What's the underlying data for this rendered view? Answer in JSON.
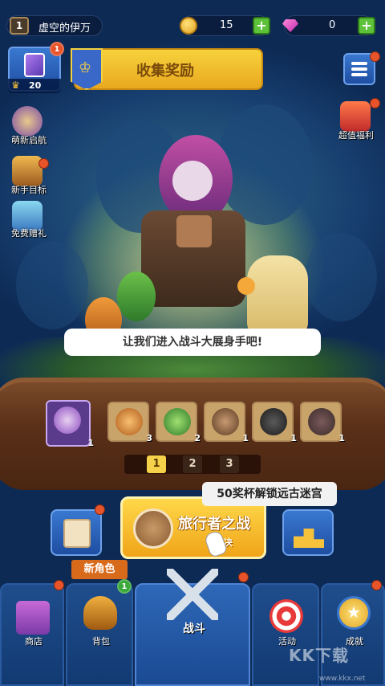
{
  "player": {
    "level": "1",
    "name": "虚空的伊万"
  },
  "currency": {
    "coins": "15",
    "gems": "0",
    "plus": "+"
  },
  "card_widget": {
    "badge": "1",
    "trophies": "20"
  },
  "banner": {
    "label": "收集奖励"
  },
  "left_menu": [
    {
      "label": "萌新启航",
      "icon": "hero-portrait-icon"
    },
    {
      "label": "新手目标",
      "icon": "ship-icon"
    },
    {
      "label": "免费赠礼",
      "icon": "gift-icon"
    }
  ],
  "right_menu": {
    "deal_label": "超值福利",
    "deal_icon": "gift-box-icon"
  },
  "speech": "让我们进入战斗大展身手吧!",
  "roster": [
    {
      "icon": "purple-mage-portrait",
      "count": "1"
    },
    {
      "icon": "orange-archer-portrait",
      "count": "3"
    },
    {
      "icon": "green-elf-portrait",
      "count": "2"
    },
    {
      "icon": "golem-portrait",
      "count": "1"
    },
    {
      "icon": "bomb-portrait",
      "count": "1"
    },
    {
      "icon": "cannon-portrait",
      "count": "1"
    }
  ],
  "pages": [
    "1",
    "2",
    "3"
  ],
  "tooltip": "50奖杯解锁远古迷宫",
  "battle": {
    "title": "旅行者之战",
    "subtitle": "对决"
  },
  "new_role_tag": "新角色",
  "nav": [
    {
      "label": "商店",
      "icon": "shop-icon"
    },
    {
      "label": "背包",
      "icon": "helmet-icon",
      "badge": "1"
    },
    {
      "label": "战斗",
      "icon": "crossed-swords-icon"
    },
    {
      "label": "活动",
      "icon": "target-icon"
    },
    {
      "label": "成就",
      "icon": "star-medal-icon"
    }
  ],
  "watermark": {
    "brand": "KK下载",
    "url": "www.kkx.net"
  },
  "colors": {
    "accent_gold": "#f6d23c",
    "panel_blue": "#1e4ea2",
    "alert_red": "#e8542a"
  }
}
